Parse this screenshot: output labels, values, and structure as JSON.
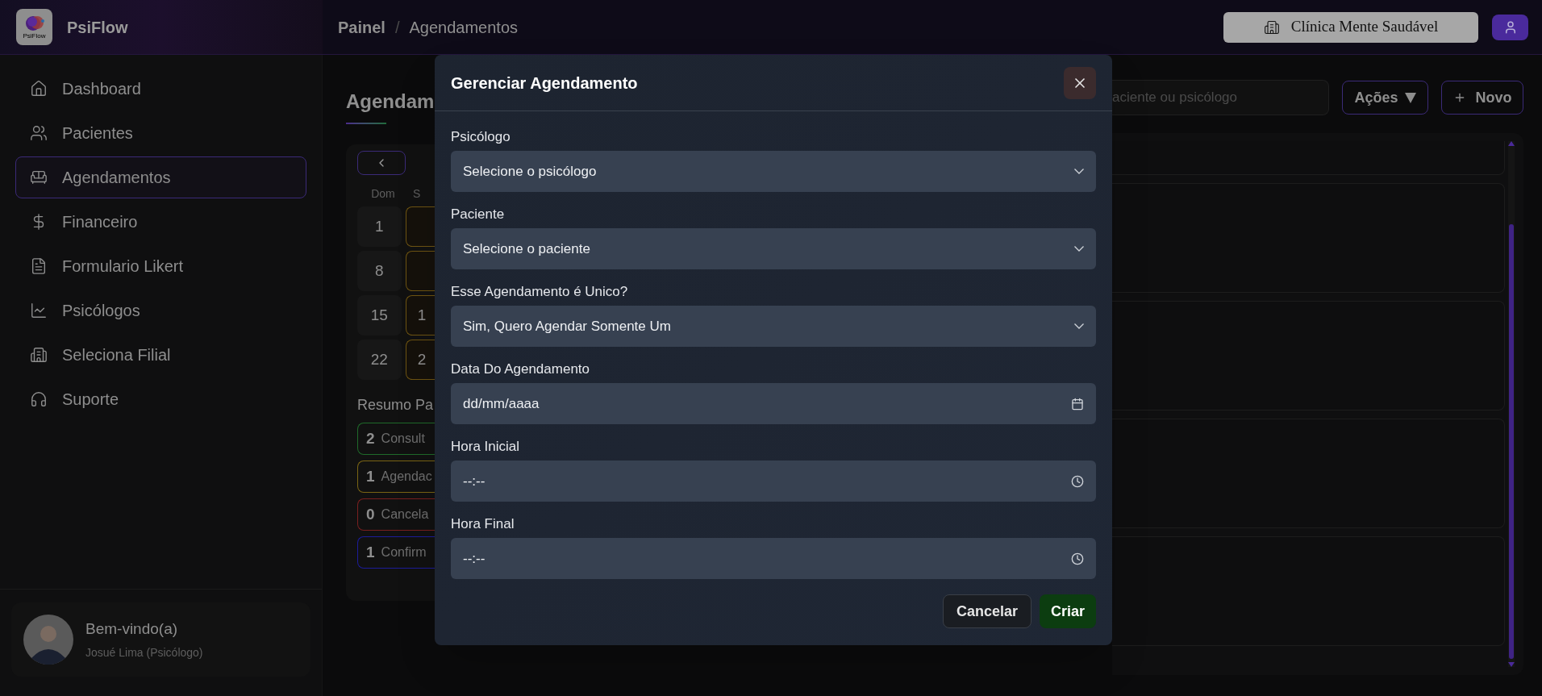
{
  "header": {
    "logo_text": "PsiFlow",
    "brand": "PsiFlow",
    "breadcrumb": [
      "Painel",
      "Agendamentos"
    ],
    "separator": "/",
    "clinic_button": "Clínica Mente Saudável"
  },
  "sidebar": {
    "items": [
      {
        "label": "Dashboard",
        "selected": false
      },
      {
        "label": "Pacientes",
        "selected": false
      },
      {
        "label": "Agendamentos",
        "selected": true
      },
      {
        "label": "Financeiro",
        "selected": false
      },
      {
        "label": "Formulario Likert",
        "selected": false
      },
      {
        "label": "Psicólogos",
        "selected": false
      },
      {
        "label": "Seleciona Filial",
        "selected": false
      },
      {
        "label": "Suporte",
        "selected": false
      }
    ],
    "user": {
      "greeting": "Bem-vindo(a)",
      "name": "Josué Lima (Psicólogo)"
    }
  },
  "main": {
    "title": "Agendam",
    "calendar": {
      "weekdays": [
        "Dom",
        "S"
      ],
      "weeks": [
        {
          "sunday": "1"
        },
        {
          "sunday": "8"
        },
        {
          "sunday": "15",
          "monday": "1"
        },
        {
          "sunday": "22",
          "monday": "2"
        }
      ]
    },
    "summary_title": "Resumo Pa",
    "summary": [
      {
        "count": "2",
        "label": "Consult",
        "color": "#1f6a2a"
      },
      {
        "count": "1",
        "label": "Agendac",
        "color": "#7a6414"
      },
      {
        "count": "0",
        "label": "Cancela",
        "color": "#7a1f1f"
      },
      {
        "count": "1",
        "label": "Confirm",
        "color": "#1c1c9a"
      }
    ],
    "search": {
      "placeholder": "aciente ou psicólogo"
    },
    "actions_button": "Ações",
    "new_button": "Novo"
  },
  "modal": {
    "title": "Gerenciar Agendamento",
    "fields": [
      {
        "label": "Psicólogo",
        "kind": "select",
        "text": "Selecione o psicólogo"
      },
      {
        "label": "Paciente",
        "kind": "select",
        "text": "Selecione o paciente"
      },
      {
        "label": "Esse Agendamento é Unico?",
        "kind": "select",
        "text": "Sim, Quero Agendar Somente Um"
      },
      {
        "label": "Data Do Agendamento",
        "kind": "date",
        "text": "dd/mm/aaaa"
      },
      {
        "label": "Hora Inicial",
        "kind": "time",
        "text": "--:--"
      },
      {
        "label": "Hora Final",
        "kind": "time",
        "text": "--:--"
      }
    ],
    "cancel_button": "Cancelar",
    "submit_button": "Criar"
  }
}
